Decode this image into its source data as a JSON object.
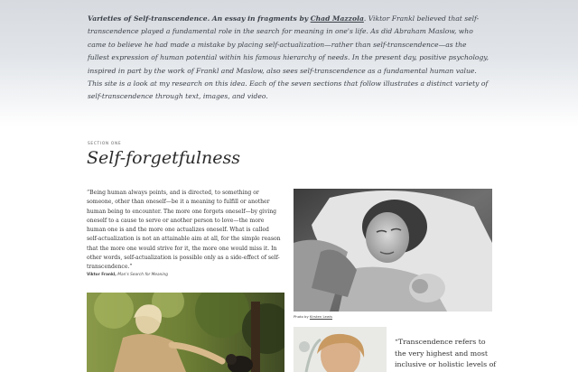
{
  "intro": {
    "title": "Varieties of Self-transcendence.",
    "byline_prefix": "An essay in fragments by",
    "author": "Chad Mazzola",
    "body": ". Viktor Frankl believed that self-transcendence played a fundamental role in the search for meaning in one's life. As did Abraham Maslow, who came to believe he had made a mistake by placing self-actualization—rather than self-transcendence—as the fullest expression of human potential within his famous hierarchy of needs. In the present day, positive psychology, inspired in part by the work of Frankl and Maslow, also sees self-transcendence as a fundamental human value. This site is a look at my research on this idea. Each of the seven sections that follow illustrates a distinct variety of self-transcendence through text, images, and video."
  },
  "section": {
    "kicker": "SECTION ONE",
    "title": "Self-forgetfulness"
  },
  "quote1": {
    "text": "“Being human always points, and is directed, to something or someone, other than oneself—be it a meaning to fulfill or another human being to encounter. The more one forgets oneself—by giving oneself to a cause to serve or another person to love—the more human one is and the more one actualizes oneself. What is called self-actualization is not an attainable aim at all, for the simple reason that the more one would strive for it, the more one would miss it. In other words, self-actualization is possible only as a side-effect of self-transcendence.”",
    "author": "Viktor Frankl,",
    "source": "Man's Search for Meaning"
  },
  "photo_credit": {
    "prefix": "Photo by",
    "name": "Kirsten Lewis"
  },
  "quote2": {
    "text": "“Transcendence refers to the very highest and most inclusive or holistic levels of"
  },
  "icons": {
    "photo_birth": "newborn-photo",
    "photo_goodall": "chimpanzee-photo",
    "photo_small": "portrait-photo"
  }
}
